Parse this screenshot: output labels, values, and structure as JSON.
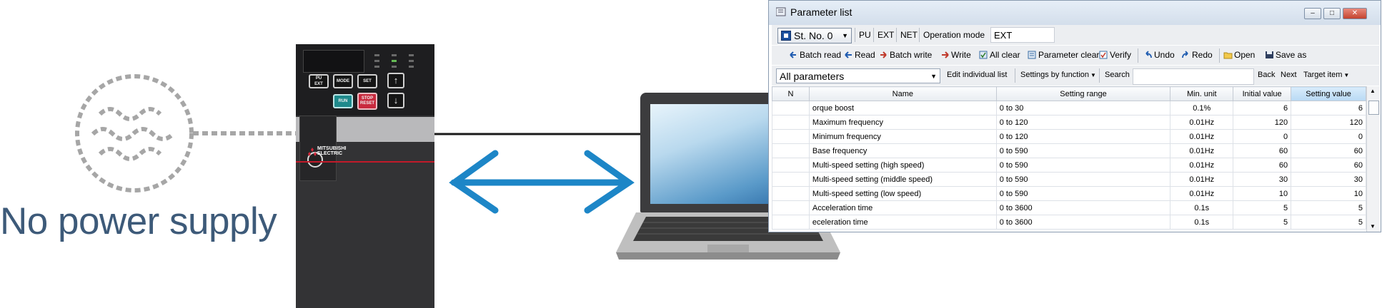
{
  "scene": {
    "no_power_label": "No power supply"
  },
  "inverter": {
    "buttons": {
      "pu_ext": "PU\nEXT",
      "mode": "MODE",
      "set": "SET",
      "up": "↑",
      "run": "RUN",
      "stop_reset": "STOP\nRESET",
      "down": "↓"
    },
    "brand": "MITSUBISHI\nELECTRIC",
    "colors": {
      "run": "#1f8a8c",
      "stop": "#c92a3e",
      "brand_line": "#c21a2a"
    }
  },
  "window": {
    "title": "Parameter list",
    "toolbar1": {
      "station": "St. No. 0",
      "pu": "PU",
      "ext": "EXT",
      "net": "NET",
      "operation_mode_label": "Operation mode",
      "operation_mode_value": "EXT"
    },
    "toolbar2": {
      "batch_read": "Batch read",
      "read": "Read",
      "batch_write": "Batch write",
      "write": "Write",
      "all_clear": "All clear",
      "parameter_clear": "Parameter clear",
      "verify": "Verify",
      "undo": "Undo",
      "redo": "Redo",
      "open": "Open",
      "save_as": "Save as"
    },
    "toolbar3": {
      "filter": "All parameters",
      "edit_individual_list": "Edit individual list",
      "settings_by_function": "Settings by function",
      "search": "Search",
      "back": "Back",
      "next": "Next",
      "target_item": "Target item"
    },
    "table": {
      "headers": [
        "N",
        "Name",
        "Setting range",
        "Min. unit",
        "Initial value",
        "Setting value"
      ],
      "rows": [
        [
          "",
          "orque boost",
          "0 to 30",
          "0.1%",
          "6",
          "6"
        ],
        [
          "",
          "Maximum frequency",
          "0 to 120",
          "0.01Hz",
          "120",
          "120"
        ],
        [
          "",
          "Minimum frequency",
          "0 to 120",
          "0.01Hz",
          "0",
          "0"
        ],
        [
          "",
          "Base frequency",
          "0 to 590",
          "0.01Hz",
          "60",
          "60"
        ],
        [
          "",
          "Multi-speed setting (high speed)",
          "0 to 590",
          "0.01Hz",
          "60",
          "60"
        ],
        [
          "",
          "Multi-speed setting (middle speed)",
          "0 to 590",
          "0.01Hz",
          "30",
          "30"
        ],
        [
          "",
          "Multi-speed setting (low speed)",
          "0 to 590",
          "0.01Hz",
          "10",
          "10"
        ],
        [
          "",
          "Acceleration time",
          "0 to 3600",
          "0.1s",
          "5",
          "5"
        ],
        [
          "",
          "eceleration time",
          "0 to 3600",
          "0.1s",
          "5",
          "5"
        ]
      ]
    }
  }
}
